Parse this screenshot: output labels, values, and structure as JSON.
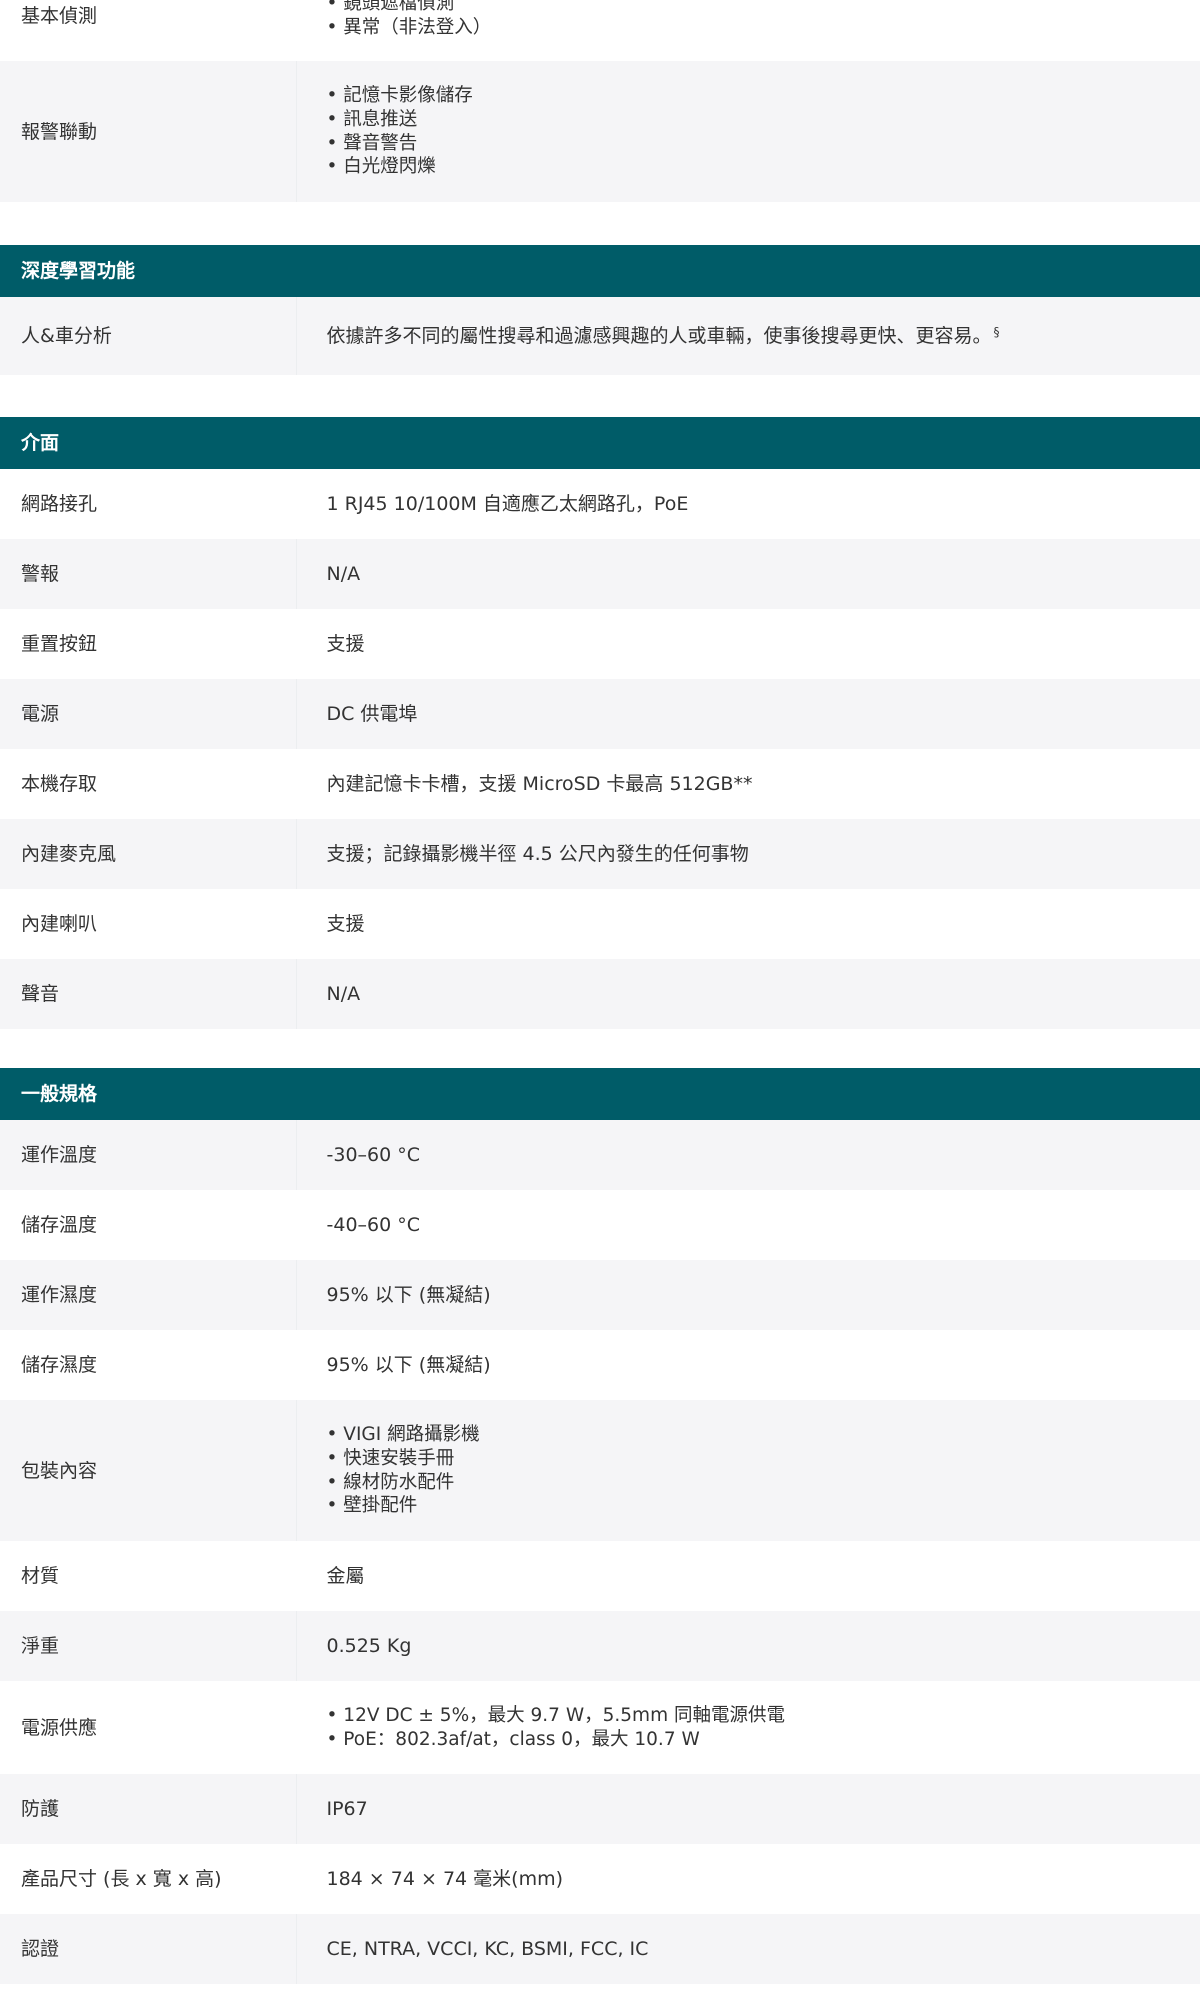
{
  "top_section": {
    "rows": [
      {
        "key": "基本偵測",
        "values": [
          "鏡頭遮檔偵測",
          "異常（非法登入）"
        ]
      },
      {
        "key": "報警聯動",
        "values": [
          "記憶卡影像儲存",
          "訊息推送",
          "聲音警告",
          "白光燈閃爍"
        ]
      }
    ]
  },
  "deep_learning": {
    "title": "深度學習功能",
    "rows": [
      {
        "key": "人&車分析",
        "value": "依據許多不同的屬性搜尋和過濾感興趣的人或車輛，使事後搜尋更快、更容易。",
        "note": "§"
      }
    ]
  },
  "interface": {
    "title": "介面",
    "rows": [
      {
        "key": "網路接孔",
        "value": "1 RJ45 10/100M 自適應乙太網路孔，PoE"
      },
      {
        "key": "警報",
        "value": "N/A"
      },
      {
        "key": "重置按鈕",
        "value": "支援"
      },
      {
        "key": "電源",
        "value": "DC 供電埠"
      },
      {
        "key": "本機存取",
        "value": "內建記憶卡卡槽，支援 MicroSD 卡最高 512GB**"
      },
      {
        "key": "內建麥克風",
        "value": "支援；記錄攝影機半徑 4.5 公尺內發生的任何事物"
      },
      {
        "key": "內建喇叭",
        "value": "支援"
      },
      {
        "key": "聲音",
        "value": "N/A"
      }
    ]
  },
  "general": {
    "title": "一般規格",
    "rows": [
      {
        "key": "運作溫度",
        "value": "-30–60 °C"
      },
      {
        "key": "儲存溫度",
        "value": "-40–60 °C"
      },
      {
        "key": "運作濕度",
        "value": "95% 以下 (無凝結)"
      },
      {
        "key": "儲存濕度",
        "value": "95% 以下 (無凝結)"
      },
      {
        "key": "包裝內容",
        "values": [
          "VIGI 網路攝影機",
          "快速安裝手冊",
          "線材防水配件",
          "壁掛配件"
        ]
      },
      {
        "key": "材質",
        "value": "金屬"
      },
      {
        "key": "淨重",
        "value": "0.525 Kg"
      },
      {
        "key": "電源供應",
        "values": [
          "12V DC ± 5%，最大 9.7 W，5.5mm 同軸電源供電",
          "PoE：802.3af/at，class 0，最大 10.7 W"
        ]
      },
      {
        "key": "防護",
        "value": "IP67"
      },
      {
        "key": "產品尺寸 (長 x 寬 x 高)",
        "value": "184 × 74 × 74 毫米(mm)"
      },
      {
        "key": "認證",
        "value": "CE, NTRA, VCCI, KC, BSMI, FCC, IC"
      }
    ]
  },
  "colors": {
    "section_header_bg": "#005c68",
    "row_alt_bg": "#f5f5f7"
  }
}
